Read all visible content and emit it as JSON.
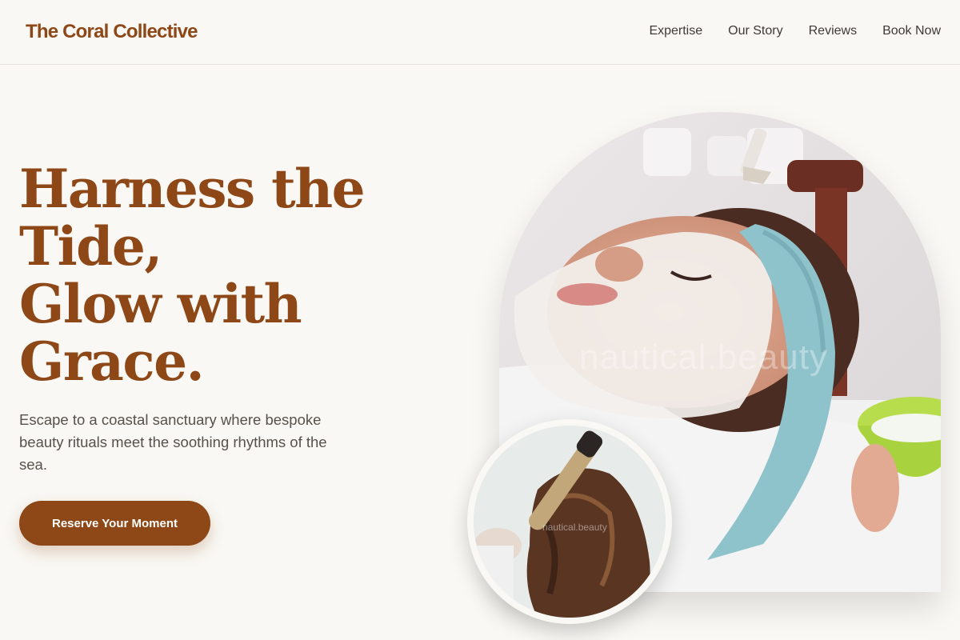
{
  "header": {
    "brand": "The Coral Collective",
    "nav": [
      {
        "label": "Expertise"
      },
      {
        "label": "Our Story"
      },
      {
        "label": "Reviews"
      },
      {
        "label": "Book Now"
      }
    ]
  },
  "hero": {
    "headline_lines": [
      "Harness the",
      "Tide,",
      "Glow with",
      "Grace."
    ],
    "subcopy": "Escape to a coastal sanctuary where bespoke beauty rituals meet the soothing rhythms of the sea.",
    "cta_label": "Reserve Your Moment",
    "main_image_watermark": "nautical.beauty",
    "secondary_image_watermark": "nautical.beauty"
  },
  "colors": {
    "accent": "#8e4716",
    "background": "#f9f8f4",
    "headband": "#8fc3cc",
    "bowl": "#b7dd4c"
  },
  "icons": {
    "main_image": "facial-treatment-photo",
    "secondary_image": "hair-curling-photo"
  }
}
